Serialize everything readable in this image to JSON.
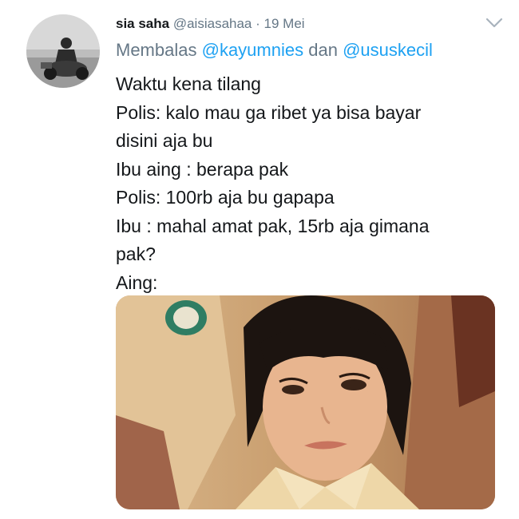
{
  "tweet": {
    "author_name": "sia saha",
    "author_handle": "@aisiasahaa",
    "separator": "·",
    "date": "19 Mei",
    "reply_prefix": "Membalas",
    "reply_mention_1": "@kayumnies",
    "reply_connector": "dan",
    "reply_mention_2": "@ususkecil",
    "lines": [
      "Waktu kena tilang",
      "Polis: kalo mau ga ribet ya bisa bayar",
      "disini aja bu",
      "Ibu aing : berapa pak",
      "Polis: 100rb aja bu gapapa",
      "Ibu : mahal amat pak, 15rb aja gimana",
      "pak?",
      "Aing:"
    ]
  },
  "icons": {
    "menu": "chevron-down-icon"
  },
  "colors": {
    "name": "#14171a",
    "secondary": "#657786",
    "mention": "#1da1f2",
    "background": "#ffffff"
  }
}
